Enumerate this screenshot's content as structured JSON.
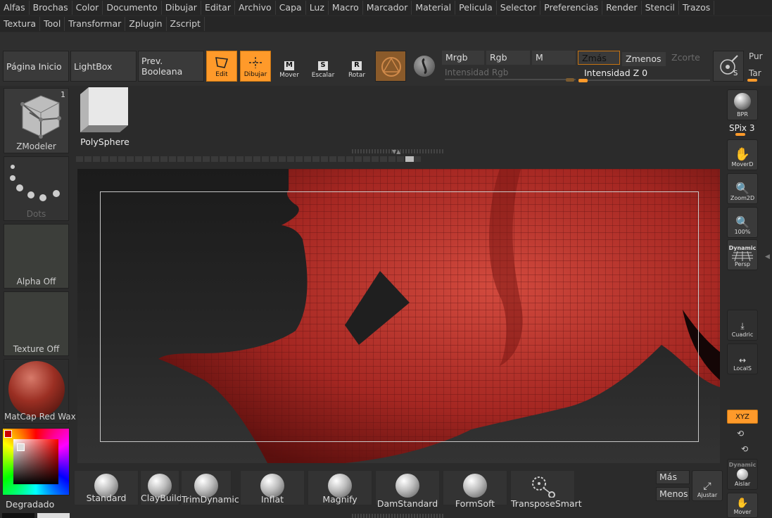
{
  "menu1": [
    "Alfas",
    "Brochas",
    "Color",
    "Documento",
    "Dibujar",
    "Editar",
    "Archivo",
    "Capa",
    "Luz",
    "Macro",
    "Marcador",
    "Material",
    "Pelicula",
    "Selector",
    "Preferencias",
    "Render",
    "Stencil",
    "Trazos"
  ],
  "menu2": [
    "Textura",
    "Tool",
    "Transformar",
    "Zplugin",
    "Zscript"
  ],
  "shelf": {
    "home": "Página Inicio",
    "lightbox": "LightBox",
    "boolean": "Prev. Booleana",
    "edit": "Edit",
    "draw": "Dibujar",
    "move": "Mover",
    "scale": "Escalar",
    "rotate": "Rotar",
    "move_key": "M",
    "scale_key": "S",
    "rotate_key": "R",
    "mrgb": "Mrgb",
    "rgb": "Rgb",
    "m": "M",
    "zadd": "Zmás",
    "zsub": "Zmenos",
    "zcut": "Zcorte",
    "rgb_intensity": "Intensidad Rgb",
    "z_intensity": "Intensidad Z 0",
    "pur": "Pur",
    "tar": "Tar"
  },
  "left": {
    "tool_count": "1",
    "tool_name": "ZModeler",
    "stroke": "Dots",
    "alpha": "Alpha Off",
    "texture": "Texture Off",
    "material": "MatCap Red Wax",
    "gradient": "Degradado"
  },
  "subtool": "PolySphere",
  "right": {
    "bpr": "BPR",
    "spix": "SPix 3",
    "moverd": "MoverD",
    "zoom2d": "Zoom2D",
    "pct": "100%",
    "dynamic": "Dynamic",
    "persp": "Persp",
    "floor": "Cuadric",
    "local": "LocalS",
    "xyz": "XYZ",
    "dynamic2": "Dynamic",
    "solo": "Aislar",
    "move": "Mover"
  },
  "brushes": [
    "Standard",
    "ClayBuildup",
    "TrimDynamic",
    "Inflat",
    "Magnify",
    "DamStandard",
    "FormSoft",
    "TransposeSmart"
  ],
  "bottom": {
    "more": "Más",
    "less": "Menos",
    "fit": "Ajustar"
  },
  "colors": {
    "accent": "#ff9a2a",
    "clay": "#b32a2a",
    "bg": "#2b2b2b"
  }
}
